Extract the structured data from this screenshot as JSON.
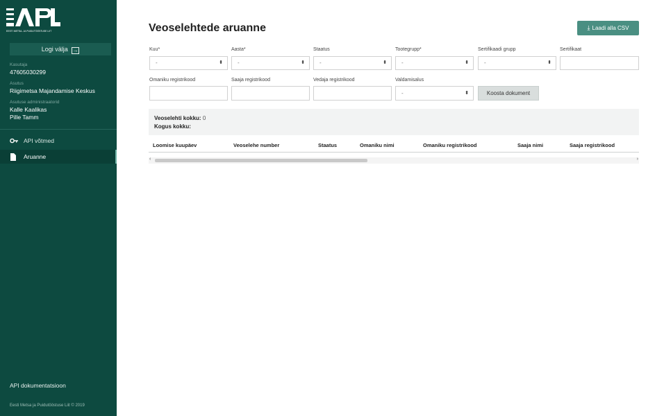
{
  "sidebar": {
    "logo_text": "EMPL",
    "logo_caption": "EESTI METSA- JA PUIDUTÖÖSTUSE LIIT",
    "logout_label": "Logi välja",
    "user_label": "Kasutaja",
    "user_value": "47605030299",
    "org_label": "Asutus",
    "org_value": "Riigimetsa Majandamise Keskus",
    "admins_label": "Asutuse administraatorid",
    "admins": [
      "Kalle Kaalikas",
      "Pille Tamm"
    ],
    "nav": [
      {
        "label": "API võtmed",
        "icon": "key-icon"
      },
      {
        "label": "Aruanne",
        "icon": "document-icon"
      }
    ],
    "api_doc": "API dokumentatsioon",
    "copyright": "Eesti Metsa ja Puidutööstuse Liit © 2019"
  },
  "main": {
    "title": "Veoselehtede aruanne",
    "csv_button": "Laadi alla CSV",
    "filters": {
      "kuu_label": "Kuu*",
      "kuu_value": "-",
      "aasta_label": "Aasta*",
      "aasta_value": "-",
      "staatus_label": "Staatus",
      "staatus_value": "-",
      "tootegrupp_label": "Tootegrupp*",
      "tootegrupp_value": "-",
      "sert_grupp_label": "Sertifikaadi grupp",
      "sert_grupp_value": "-",
      "sert_label": "Sertifikaat",
      "sert_value": "",
      "omaniku_label": "Omaniku registrikood",
      "omaniku_value": "",
      "saaja_label": "Saaja registrikood",
      "saaja_value": "",
      "vedaja_label": "Vedaja registrikood",
      "vedaja_value": "",
      "valdamisalus_label": "Valdamisalus",
      "valdamisalus_value": "-"
    },
    "build_button": "Koosta dokument",
    "summary": {
      "count_label": "Veoselehti kokku:",
      "count_value": "0",
      "amount_label": "Kogus kokku:",
      "amount_value": ""
    },
    "table_headers": [
      "Loomise kuupäev",
      "Veoselehe number",
      "Staatus",
      "Omaniku nimi",
      "Omaniku registrikood",
      "Saaja nimi",
      "Saaja registrikood"
    ]
  }
}
